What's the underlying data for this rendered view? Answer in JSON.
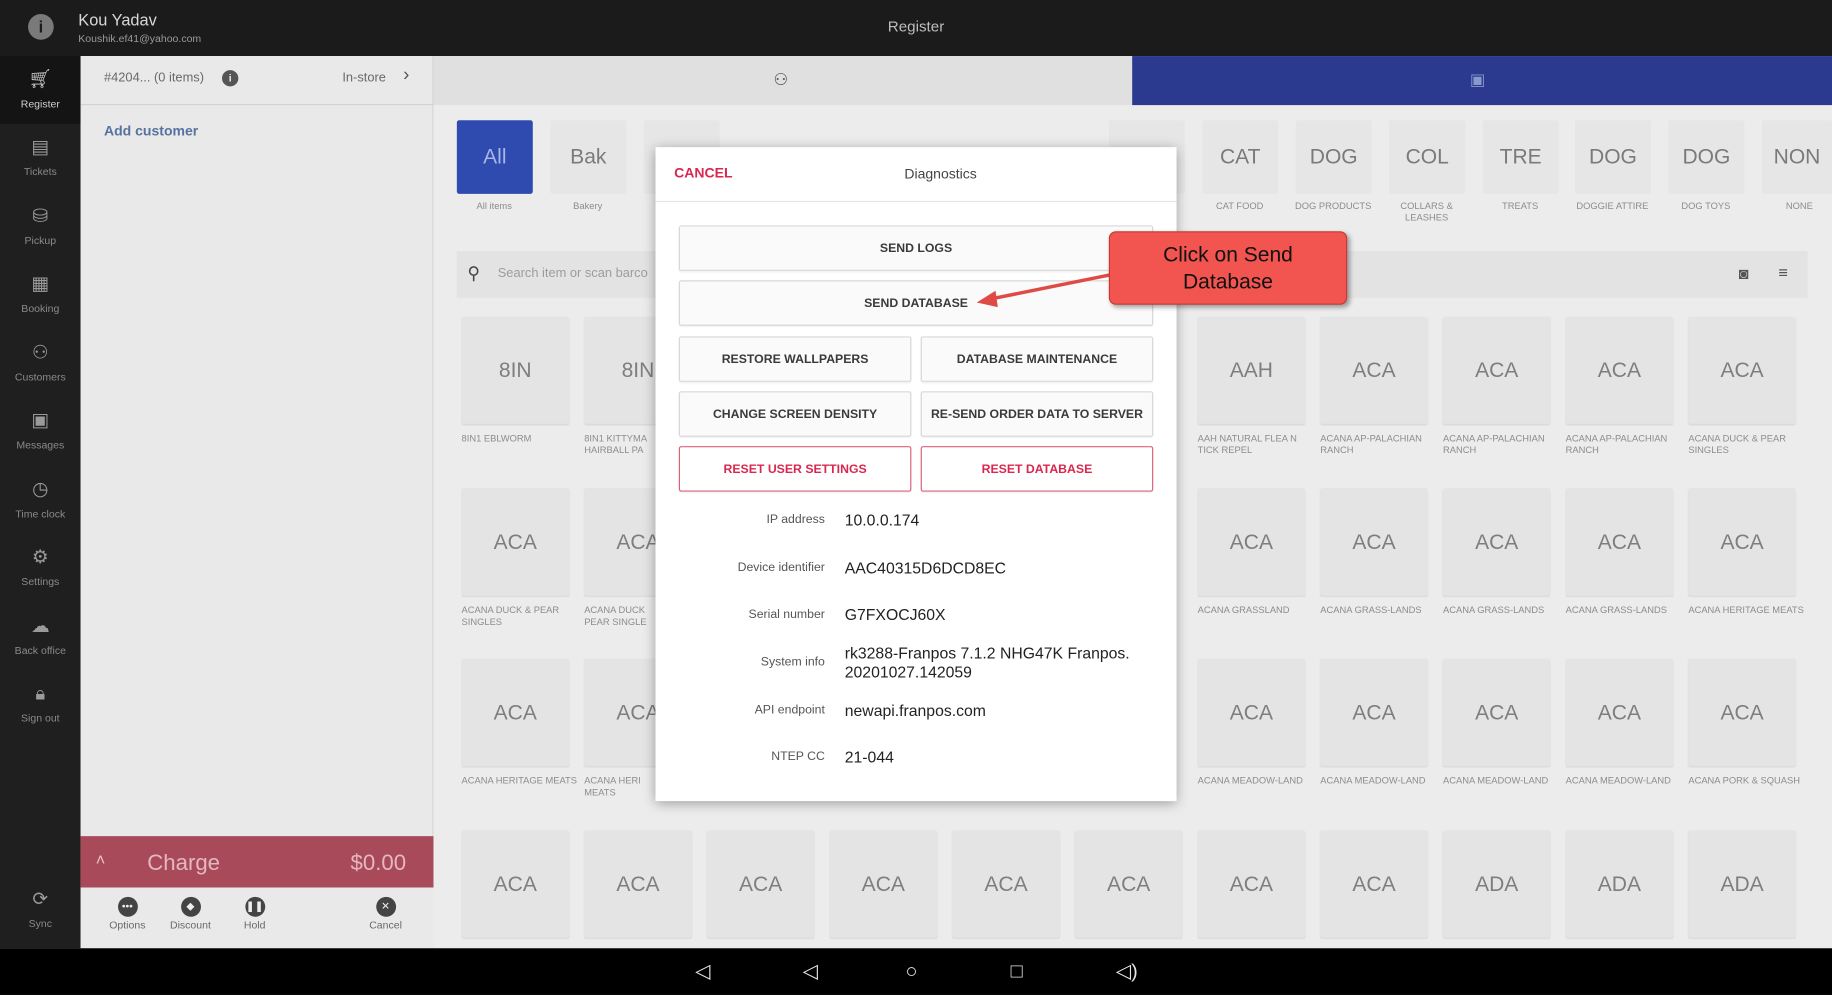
{
  "header": {
    "user_name": "Kou Yadav",
    "user_email": "Koushik.ef41@yahoo.com",
    "title": "Register"
  },
  "nav": {
    "items": [
      {
        "label": "Register",
        "icon": "cart-icon"
      },
      {
        "label": "Tickets",
        "icon": "tickets-icon"
      },
      {
        "label": "Pickup",
        "icon": "pickup-icon"
      },
      {
        "label": "Booking",
        "icon": "calendar-icon"
      },
      {
        "label": "Customers",
        "icon": "people-icon"
      },
      {
        "label": "Messages",
        "icon": "chat-icon"
      },
      {
        "label": "Time clock",
        "icon": "clock-icon"
      },
      {
        "label": "Settings",
        "icon": "gear-icon"
      },
      {
        "label": "Back office",
        "icon": "cloud-icon"
      },
      {
        "label": "Sign out",
        "icon": "lock-icon"
      }
    ],
    "sync_label": "Sync"
  },
  "order": {
    "number": "#4204... (0 items)",
    "type": "In-store",
    "add_customer": "Add customer",
    "charge_label": "Charge",
    "charge_total": "$0.00",
    "actions": [
      "Options",
      "Discount",
      "Hold",
      "Cancel"
    ]
  },
  "categories": [
    {
      "short": "All",
      "name": "All items"
    },
    {
      "short": "Bak",
      "name": "Bakery"
    },
    {
      "short": "CAT",
      "name": "CAT FOOD"
    },
    {
      "short": "DOG",
      "name": "DOG PRODUCTS"
    },
    {
      "short": "COL",
      "name": "COLLARS & LEASHES"
    },
    {
      "short": "TRE",
      "name": "TREATS"
    },
    {
      "short": "DOG",
      "name": "DOGGIE ATTIRE"
    },
    {
      "short": "DOG",
      "name": "DOG TOYS"
    },
    {
      "short": "NON",
      "name": "NONE"
    }
  ],
  "search": {
    "placeholder": "Search item or scan barco"
  },
  "grid": {
    "left_cols": [
      [
        {
          "short": "8IN",
          "name": "8IN1 EBLWORM"
        },
        {
          "short": "8IN",
          "name": "8IN1 KITTYMA HAIRBALL PA"
        }
      ],
      [
        {
          "short": "ACA",
          "name": "ACANA DUCK & PEAR SINGLES"
        },
        {
          "short": "ACA",
          "name": "ACANA DUCK PEAR SINGLE"
        }
      ],
      [
        {
          "short": "ACA",
          "name": "ACANA HERITAGE MEATS"
        },
        {
          "short": "ACA",
          "name": "ACANA HERI MEATS"
        }
      ]
    ],
    "right_rows": [
      [
        {
          "short": "AAH",
          "name": "AAH NATURAL FLEA N TICK REPEL"
        },
        {
          "short": "ACA",
          "name": "ACANA AP-PALACHIAN RANCH"
        },
        {
          "short": "ACA",
          "name": "ACANA AP-PALACHIAN RANCH"
        },
        {
          "short": "ACA",
          "name": "ACANA AP-PALACHIAN RANCH"
        },
        {
          "short": "ACA",
          "name": "ACANA DUCK & PEAR SINGLES"
        }
      ],
      [
        {
          "short": "ACA",
          "name": "ACANA GRASSLAND"
        },
        {
          "short": "ACA",
          "name": "ACANA GRASS-LANDS"
        },
        {
          "short": "ACA",
          "name": "ACANA GRASS-LANDS"
        },
        {
          "short": "ACA",
          "name": "ACANA GRASS-LANDS"
        },
        {
          "short": "ACA",
          "name": "ACANA HERITAGE MEATS"
        }
      ],
      [
        {
          "short": "ACA",
          "name": "ACANA MEADOW-LAND"
        },
        {
          "short": "ACA",
          "name": "ACANA MEADOW-LAND"
        },
        {
          "short": "ACA",
          "name": "ACANA MEADOW-LAND"
        },
        {
          "short": "ACA",
          "name": "ACANA MEADOW-LAND"
        },
        {
          "short": "ACA",
          "name": "ACANA PORK & SQUASH"
        }
      ]
    ],
    "bottom_row": [
      "ACA",
      "ACA",
      "ACA",
      "ACA",
      "ACA",
      "ACA",
      "ACA",
      "ACA",
      "ADA",
      "ADA",
      "ADA"
    ]
  },
  "dialog": {
    "cancel": "CANCEL",
    "title": "Diagnostics",
    "buttons": {
      "send_logs": "SEND LOGS",
      "send_database": "SEND DATABASE",
      "restore_wallpapers": "RESTORE WALLPAPERS",
      "database_maintenance": "DATABASE MAINTENANCE",
      "change_screen_density": "CHANGE SCREEN DENSITY",
      "resend_order_data": "RE-SEND ORDER DATA TO SERVER",
      "reset_user_settings": "RESET USER SETTINGS",
      "reset_database": "RESET DATABASE"
    },
    "info": [
      {
        "label": "IP address",
        "value": "10.0.0.174"
      },
      {
        "label": "Device identifier",
        "value": "AAC40315D6DCD8EC"
      },
      {
        "label": "Serial number",
        "value": "G7FXOCJ60X"
      },
      {
        "label": "System info",
        "value": "rk3288-Franpos 7.1.2 NHG47K Franpos.\n20201027.142059"
      },
      {
        "label": "API endpoint",
        "value": "newapi.franpos.com"
      },
      {
        "label": "NTEP CC",
        "value": "21-044"
      }
    ]
  },
  "callout": {
    "text": "Click on Send\nDatabase"
  },
  "colors": {
    "accent_blue": "#2f4bb0",
    "charge_red": "#d82850",
    "callout": "#f2544f"
  }
}
